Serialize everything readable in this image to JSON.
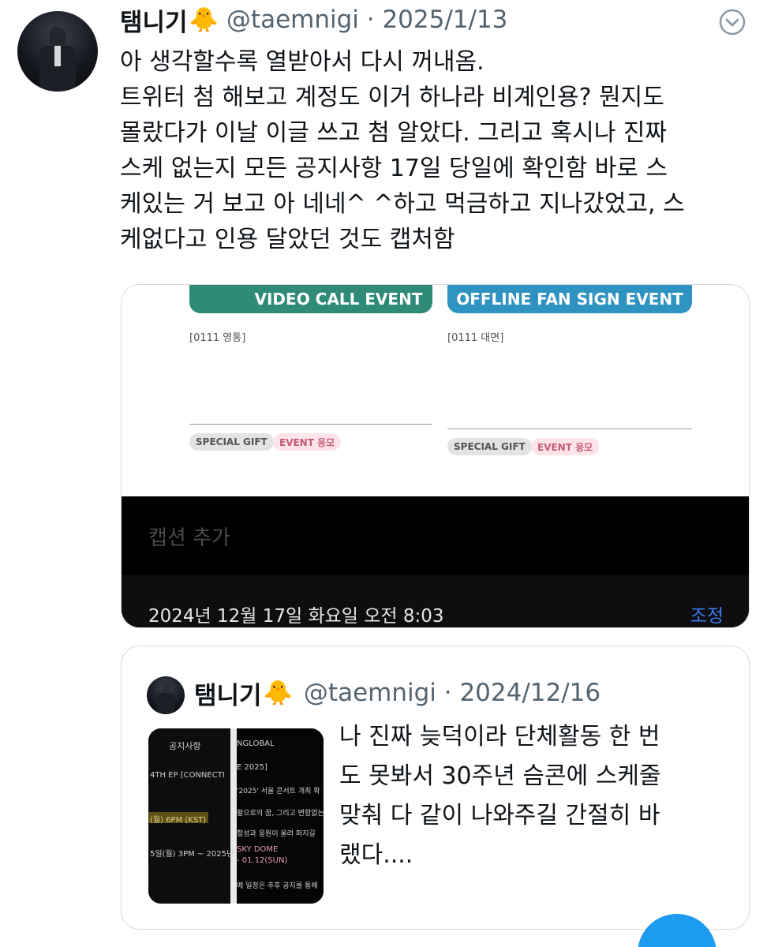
{
  "tweet": {
    "author_name": "탬니기",
    "author_emoji": "🐥",
    "handle_date": "@taemnigi · 2025/1/13",
    "lines": [
      "아 생각할수록 열받아서 다시 꺼내옴.",
      "트위터 첨 해보고 계정도 이거 하나라 비계인용? 뭔지도",
      "몰랐다가 이날 이글 쓰고 첨 알았다. 그리고 혹시나 진짜",
      "스케 없는지 모든 공지사항 17일 당일에 확인함 바로 스",
      "케있는 거 보고 아 네네^ ^하고 먹금하고 지나갔었고, 스",
      "케없다고 인용 달았던 것도 캡처함"
    ]
  },
  "media": {
    "video_call_label": "VIDEO CALL EVENT",
    "offline_label": "OFFLINE FAN SIGN EVENT",
    "left_date_label": "[0111 영통]",
    "right_date_label": "[0111 대면]",
    "special_gift": "SPECIAL GIFT",
    "event_apply": "EVENT 응모",
    "caption_placeholder": "캡션 추가",
    "timestamp": "2024년 12월 17일 화요일 오전 8:03",
    "adjust_label": "조정"
  },
  "quote": {
    "author_name": "탬니기",
    "author_emoji": "🐥",
    "handle_date": "@taemnigi · 2024/12/16",
    "lines": [
      "나 진짜 늦덕이라 단체활동 한 번",
      "도 못봐서 30주년 슴콘에 스케줄",
      "맞춰 다 같이 나와주길 간절히 바",
      "랬다...."
    ],
    "thumb": {
      "notice_title": "공지사항",
      "l1": "4TH EP [CONNECTI",
      "l2": "(월) 6PM (KST)",
      "l3": "5일(월) 3PM ~ 2025년",
      "l4": "NGLOBAL",
      "l5": "E 2025]",
      "l6": "'2025' 서울 콘서트 개최 확",
      "l7": "팔으로의 꿈, 그리고 변함없는",
      "l8": "합성과 응원이 울려 퍼지길",
      "l9": "SKY DOME",
      "l10": "- 01.12(SUN)",
      "l11": "예 일정은 추후 공지를 통해"
    }
  },
  "colors": {
    "accent": "#1d9bf0",
    "video_pill": "#2f8a78",
    "offline_pill": "#2f93c2",
    "adjust": "#3a7ef0",
    "muted": "#536471"
  }
}
